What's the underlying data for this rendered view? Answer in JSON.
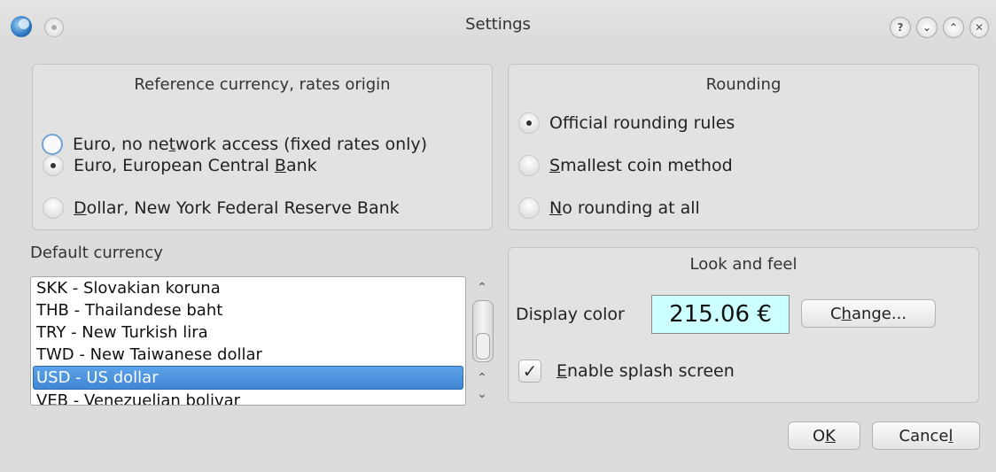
{
  "window": {
    "title": "Settings"
  },
  "rates_group": {
    "title": "Reference currency, rates origin",
    "options": [
      {
        "pre": "Euro, no ne",
        "mnemonic": "t",
        "post": "work access (fixed rates only)",
        "checked": false
      },
      {
        "pre": "Euro, European Central ",
        "mnemonic": "B",
        "post": "ank",
        "checked": true
      },
      {
        "pre": "",
        "mnemonic": "D",
        "post": "ollar, New York Federal Reserve Bank",
        "checked": false
      }
    ]
  },
  "rounding_group": {
    "title": "Rounding",
    "options": [
      {
        "pre": "Official roundin",
        "mnemonic": "g",
        "post": " rules",
        "checked": true
      },
      {
        "pre": "",
        "mnemonic": "S",
        "post": "mallest coin method",
        "checked": false
      },
      {
        "pre": "",
        "mnemonic": "N",
        "post": "o rounding at all",
        "checked": false
      }
    ]
  },
  "default_currency": {
    "label": "Default currency",
    "items": [
      "SKK - Slovakian koruna",
      "THB - Thailandese baht",
      "TRY - New Turkish lira",
      "TWD - New Taiwanese dollar",
      "USD - US dollar",
      "VEB - Venezuelian bolivar"
    ],
    "selected_index": 4
  },
  "look_group": {
    "title": "Look and feel",
    "display_color_label": "Display color",
    "display_sample": "215.06 €",
    "display_bg": "#ccffff",
    "change_pre": "C",
    "change_mnemonic": "h",
    "change_post": "ange...",
    "splash_pre": "",
    "splash_mnemonic": "E",
    "splash_post": "nable splash screen",
    "splash_checked": true
  },
  "dialog_buttons": {
    "ok_pre": "O",
    "ok_mnemonic": "K",
    "ok_post": "",
    "cancel_pre": "Cance",
    "cancel_mnemonic": "l",
    "cancel_post": ""
  },
  "icons": {
    "help": "?",
    "minimize": "⌄",
    "maximize": "⌃",
    "close": "✕",
    "scroll_up": "⌃",
    "scroll_down": "⌄",
    "check": "✓"
  }
}
